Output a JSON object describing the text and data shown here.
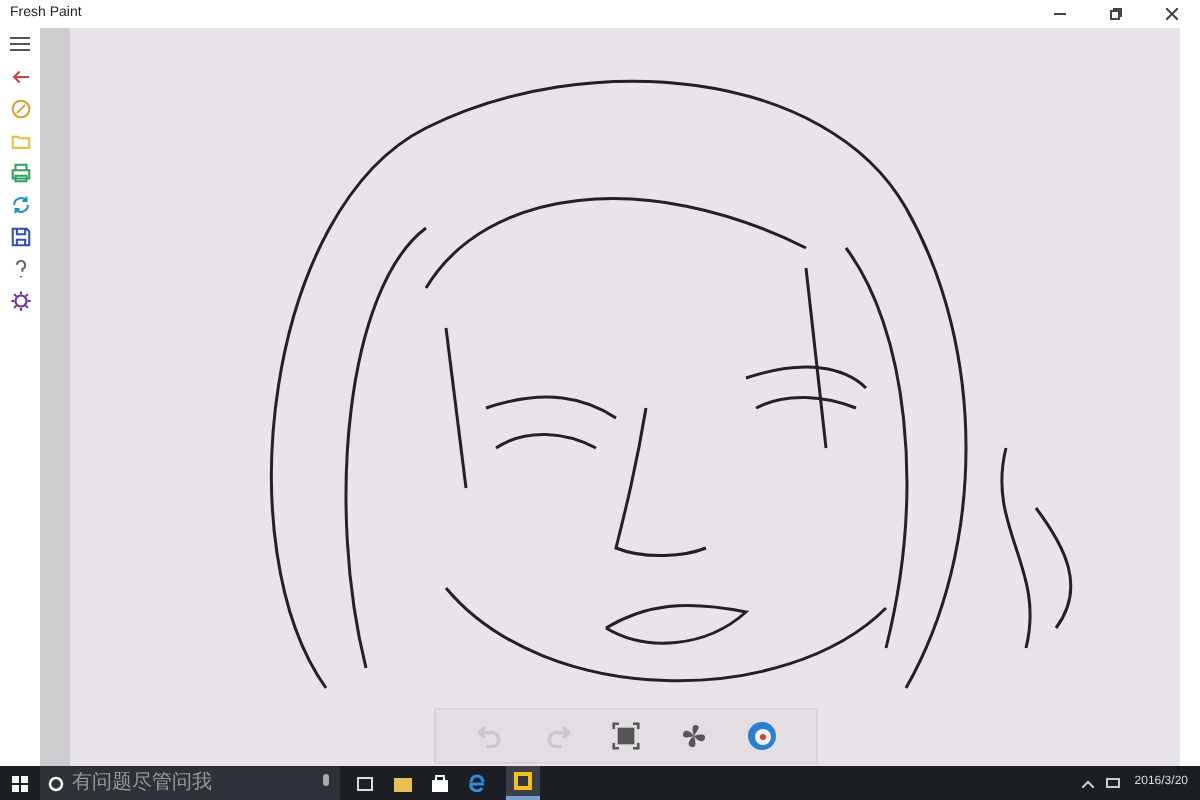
{
  "window": {
    "title": "Fresh Paint"
  },
  "toolbar": [
    {
      "kind": "undo",
      "disabled": true
    },
    {
      "kind": "redo",
      "disabled": true
    },
    {
      "kind": "fit",
      "disabled": false
    },
    {
      "kind": "fan",
      "disabled": false
    },
    {
      "kind": "color",
      "disabled": false
    }
  ],
  "taskbar": {
    "search": {
      "placeholder": "有问题尽管问我"
    },
    "date": "2016/3/20"
  }
}
